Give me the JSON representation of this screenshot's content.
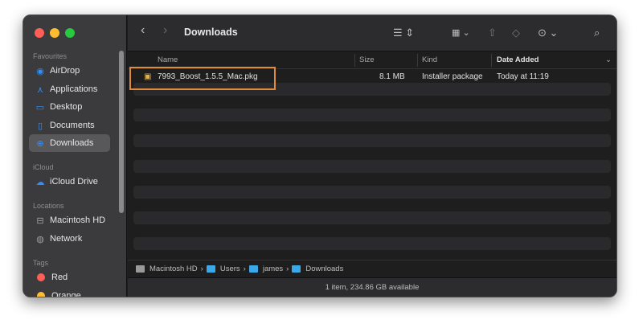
{
  "window": {
    "title": "Downloads"
  },
  "sidebar": {
    "favourites_label": "Favourites",
    "favourites": [
      {
        "label": "AirDrop",
        "icon": "airdrop-icon"
      },
      {
        "label": "Applications",
        "icon": "applications-icon"
      },
      {
        "label": "Desktop",
        "icon": "desktop-icon"
      },
      {
        "label": "Documents",
        "icon": "document-icon"
      },
      {
        "label": "Downloads",
        "icon": "downloads-icon",
        "selected": true
      }
    ],
    "icloud_label": "iCloud",
    "icloud": [
      {
        "label": "iCloud Drive",
        "icon": "cloud-icon"
      }
    ],
    "locations_label": "Locations",
    "locations": [
      {
        "label": "Macintosh HD",
        "icon": "drive-icon"
      },
      {
        "label": "Network",
        "icon": "globe-icon"
      }
    ],
    "tags_label": "Tags",
    "tags": [
      {
        "label": "Red",
        "color": "#ff5f57"
      },
      {
        "label": "Orange",
        "color": "#febc2e"
      }
    ]
  },
  "columns": {
    "name": "Name",
    "size": "Size",
    "kind": "Kind",
    "date": "Date Added"
  },
  "files": [
    {
      "name": "7993_Boost_1.5.5_Mac.pkg",
      "size": "8.1 MB",
      "kind": "Installer package",
      "date": "Today at 11:19"
    }
  ],
  "path": [
    "Macintosh HD",
    "Users",
    "james",
    "Downloads"
  ],
  "status": "1 item, 234.86 GB available",
  "colors": {
    "highlight": "#e08a3c",
    "accent": "#2f8fff"
  }
}
